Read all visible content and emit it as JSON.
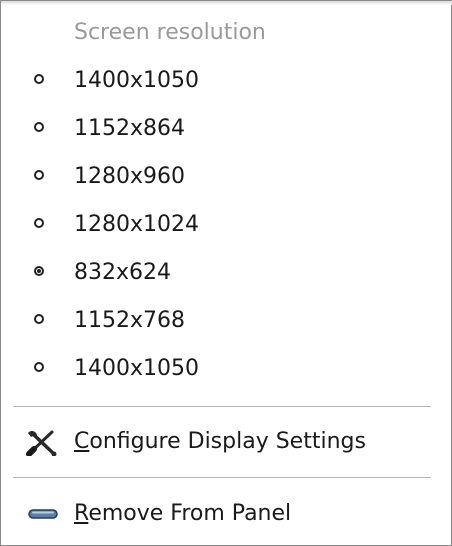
{
  "menu": {
    "header": "Screen resolution",
    "resolutions": [
      {
        "label": "1400x1050",
        "checked": false
      },
      {
        "label": "1152x864",
        "checked": false
      },
      {
        "label": "1280x960",
        "checked": false
      },
      {
        "label": "1280x1024",
        "checked": false
      },
      {
        "label": "832x624",
        "checked": true
      },
      {
        "label": "1152x768",
        "checked": false
      },
      {
        "label": "1400x1050",
        "checked": false
      }
    ],
    "configure": {
      "mnemonic": "C",
      "rest": "onfigure Display Settings",
      "icon": "tools-icon"
    },
    "remove": {
      "mnemonic": "R",
      "rest": "emove From Panel",
      "icon": "remove-icon"
    }
  }
}
